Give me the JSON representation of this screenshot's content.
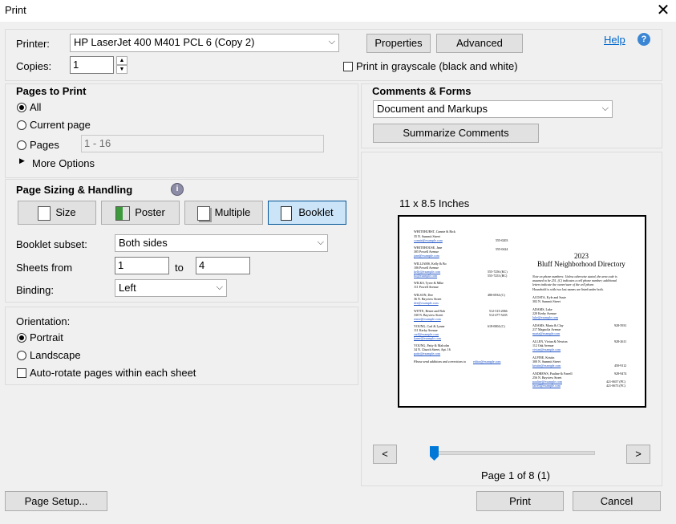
{
  "window": {
    "title": "Print",
    "close_glyph": "✕"
  },
  "printer": {
    "label": "Printer:",
    "value": "HP LaserJet 400 M401 PCL 6 (Copy 2)",
    "properties_label": "Properties",
    "advanced_label": "Advanced",
    "help_label": "Help",
    "help_glyph": "?",
    "copies_label": "Copies:",
    "copies_value": "1",
    "grayscale_label": "Print in grayscale (black and white)"
  },
  "pages": {
    "heading": "Pages to Print",
    "all_label": "All",
    "current_label": "Current page",
    "pages_label": "Pages",
    "range_value": "1 - 16",
    "more_options_label": "More Options"
  },
  "sizing": {
    "heading": "Page Sizing & Handling",
    "info_glyph": "i",
    "size_label": "Size",
    "poster_label": "Poster",
    "multiple_label": "Multiple",
    "booklet_label": "Booklet",
    "subset_label": "Booklet subset:",
    "subset_value": "Both sides",
    "sheets_label": "Sheets from",
    "sheets_from": "1",
    "to_label": "to",
    "sheets_to": "4",
    "binding_label": "Binding:",
    "binding_value": "Left"
  },
  "orientation": {
    "heading": "Orientation:",
    "portrait_label": "Portrait",
    "landscape_label": "Landscape",
    "autorotate_label": "Auto-rotate pages within each sheet"
  },
  "comments": {
    "heading": "Comments & Forms",
    "value": "Document and Markups",
    "summarize_label": "Summarize Comments"
  },
  "preview": {
    "size_label": "11 x 8.5 Inches",
    "prev_label": "<",
    "next_label": ">",
    "page_indicator": "Page 1 of 8 (1)",
    "slider_fraction": 0,
    "right_page": {
      "year": "2023",
      "title": "Bluff Neighborhood Directory"
    }
  },
  "footer": {
    "page_setup_label": "Page Setup...",
    "print_label": "Print",
    "cancel_label": "Cancel"
  }
}
